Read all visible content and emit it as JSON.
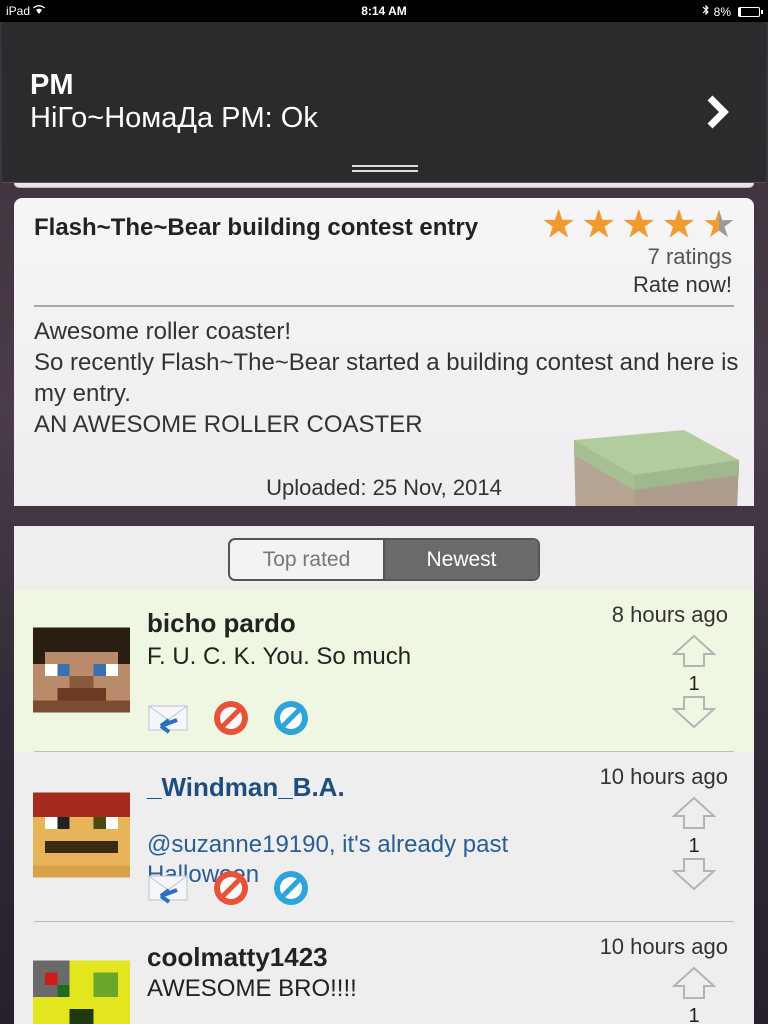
{
  "status_bar": {
    "device": "iPad",
    "time": "8:14 AM",
    "battery": "8%",
    "bluetooth_icon": "bluetooth-icon",
    "wifi_icon": "wifi-icon"
  },
  "pm_banner": {
    "title": "PM",
    "message": "НiГо~НомаДа PM: Ok",
    "chevron_icon": "chevron-right-icon"
  },
  "entry": {
    "title": "Flash~The~Bear building contest entry",
    "rating": 4.5,
    "rating_max": 5,
    "ratings_count": "7 ratings",
    "rate_now": "Rate now!",
    "description": [
      "Awesome roller coaster!",
      "So recently Flash~The~Bear started a building contest and here is my entry.",
      "AN AWESOME ROLLER COASTER"
    ],
    "uploaded": "Uploaded: 25 Nov, 2014"
  },
  "sort_tabs": {
    "top_rated": "Top rated",
    "newest": "Newest",
    "selected": "Newest"
  },
  "comments": [
    {
      "author": "bicho pardo",
      "text": "F.   U.  C.  K.  You. So much",
      "time": "8 hours ago",
      "votes": "1"
    },
    {
      "author": "_Windman_B.A.",
      "text": "@suzanne19190, it's already past Halloween",
      "time": "10 hours ago",
      "votes": "1"
    },
    {
      "author": "coolmatty1423",
      "text": "AWESOME BRO!!!!",
      "time": "10 hours ago",
      "votes": "1"
    }
  ],
  "colors": {
    "star": "#f29a2e",
    "highlight_row": "#eff7e2",
    "banner": "#2b2b2d",
    "link_blue": "#2a5d92"
  }
}
